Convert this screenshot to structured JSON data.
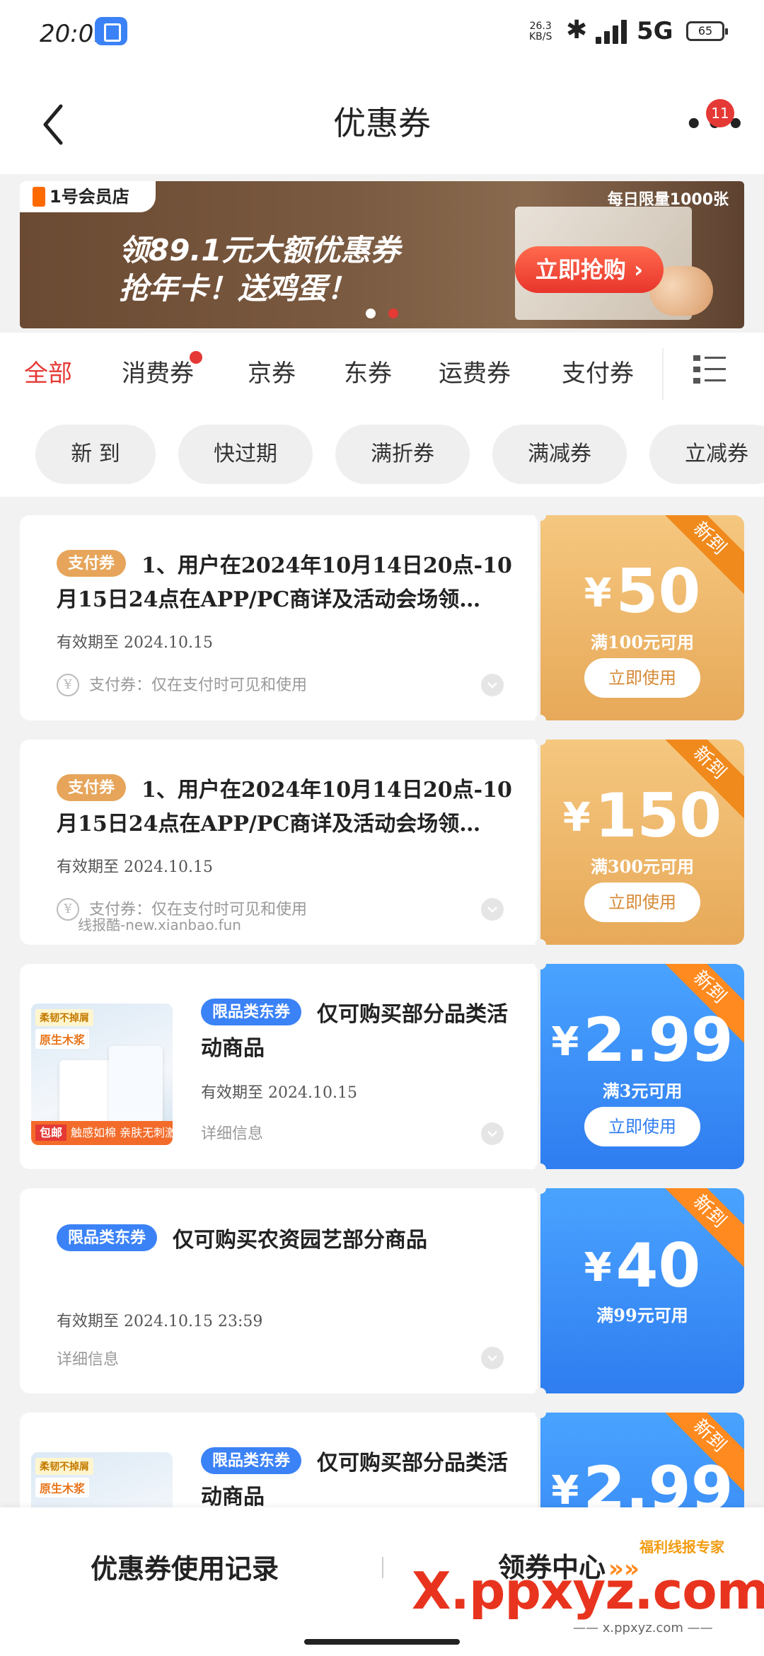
{
  "status_bar": {
    "time": "20:01",
    "net_speed_value": "26.3",
    "net_speed_unit": "KB/S",
    "network": "5G",
    "battery": "65"
  },
  "header": {
    "title": "优惠券",
    "more_badge": "11"
  },
  "banner": {
    "logo": "1号会员店",
    "line1": "领89.1元大额优惠券",
    "line2": "抢年卡！送鸡蛋！",
    "limit": "每日限量1000张",
    "cta": "立即抢购",
    "indicator_colors": {
      "inactive": "#ffffff",
      "active": "#e53935"
    }
  },
  "category_tabs": [
    "全部",
    "消费券",
    "京券",
    "东券",
    "运费券",
    "支付券"
  ],
  "filters": [
    "新  到",
    "快过期",
    "满折券",
    "满减券",
    "立减券"
  ],
  "coupons": [
    {
      "tag": "支付券",
      "title": "1、用户在2024年10月14日20点-10月15日24点在APP/PC商详及活动会场领…",
      "validity": "有效期至 2024.10.15",
      "note": "支付券：仅在支付时可见和使用",
      "note_icon": "¥",
      "new_label": "新到",
      "yen": "¥",
      "amount": "50",
      "condition": "满100元可用",
      "action": "立即使用",
      "theme": "gold"
    },
    {
      "tag": "支付券",
      "title": "1、用户在2024年10月14日20点-10月15日24点在APP/PC商详及活动会场领…",
      "validity": "有效期至 2024.10.15",
      "note": "支付券：仅在支付时可见和使用",
      "note_icon": "¥",
      "new_label": "新到",
      "yen": "¥",
      "amount": "150",
      "condition": "满300元可用",
      "action": "立即使用",
      "theme": "gold"
    },
    {
      "tag": "限品类东券",
      "title": "仅可购买部分品类活动商品",
      "validity": "有效期至 2024.10.15",
      "note": "详细信息",
      "new_label": "新到",
      "yen": "¥",
      "amount": "2.99",
      "condition": "满3元可用",
      "action": "立即使用",
      "theme": "blue",
      "product": {
        "label1": "柔韧不掉屑",
        "label2": "原生木浆",
        "bottom_tag": "包邮",
        "bottom_text": "触感如棉 亲肤无刺激"
      }
    },
    {
      "tag": "限品类东券",
      "title": "仅可购买农资园艺部分商品",
      "validity": "有效期至 2024.10.15 23:59",
      "note": "详细信息",
      "new_label": "新到",
      "yen": "¥",
      "amount": "40",
      "condition": "满99元可用",
      "theme": "blue"
    },
    {
      "tag": "限品类东券",
      "title": "仅可购买部分品类活动商品",
      "new_label": "新到",
      "yen": "¥",
      "amount": "2.99",
      "theme": "blue",
      "product": {
        "label1": "柔韧不掉屑",
        "label2": "原生木浆"
      }
    }
  ],
  "watermark": "线报酷-new.xianbao.fun",
  "bottom_bar": {
    "record": "优惠券使用记录",
    "center": "领券中心",
    "arrows": "»»"
  },
  "site_watermark": {
    "logo": "X.ppxyz.com",
    "sub": "—— x.ppxyz.com ——",
    "badge": "福利线报专家"
  },
  "colors": {
    "accent_red": "#e53935",
    "gold": "#e7a959",
    "blue": "#2f7df0",
    "ribbon": "#ff8a1f"
  }
}
